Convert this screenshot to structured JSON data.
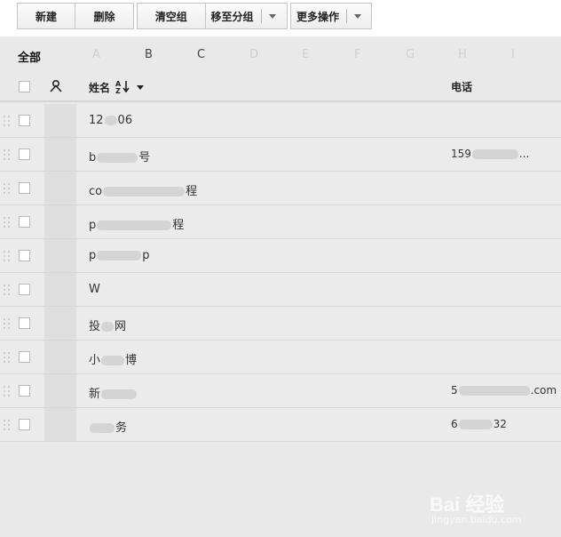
{
  "toolbar": {
    "new_label": "新建",
    "delete_label": "删除",
    "clear_group_label": "清空组",
    "move_group_label": "移至分组",
    "more_actions_label": "更多操作"
  },
  "alphabet": {
    "all_label": "全部",
    "letters": [
      "A",
      "B",
      "C",
      "D",
      "E",
      "F",
      "G",
      "H",
      "I"
    ],
    "active_letters": [
      "B",
      "C"
    ]
  },
  "header": {
    "name_label": "姓名",
    "sort_glyph": "A↓Z",
    "phone_label": "电话"
  },
  "rows": [
    {
      "name_visible": "12",
      "name_tail": "06",
      "phone_visible": "",
      "phone_tail": ""
    },
    {
      "name_visible": "b",
      "name_tail": "号",
      "phone_visible": "159",
      "phone_tail": "..."
    },
    {
      "name_visible": "co",
      "name_tail": "程",
      "phone_visible": "",
      "phone_tail": ""
    },
    {
      "name_visible": "p",
      "name_tail": "程",
      "phone_visible": "",
      "phone_tail": ""
    },
    {
      "name_visible": "p",
      "name_tail": "p",
      "phone_visible": "",
      "phone_tail": ""
    },
    {
      "name_visible": "W",
      "name_tail": "",
      "phone_visible": "",
      "phone_tail": ""
    },
    {
      "name_visible": "投",
      "name_tail": "网",
      "phone_visible": "",
      "phone_tail": ""
    },
    {
      "name_visible": "小",
      "name_tail": "博",
      "phone_visible": "",
      "phone_tail": ""
    },
    {
      "name_visible": "新",
      "name_tail": "",
      "phone_visible": "5",
      "phone_tail": ".com"
    },
    {
      "name_visible": "",
      "name_tail": "务",
      "phone_visible": "6",
      "phone_tail": "32"
    }
  ],
  "watermark": {
    "brand_text": "Bai 经验",
    "url_text": "jingyan.baidu.com"
  },
  "colors": {
    "background": "#e9e9e9",
    "row_background": "#ebebeb",
    "toolbar_background": "#ffffff",
    "muted_letter": "#cfcfcf"
  }
}
